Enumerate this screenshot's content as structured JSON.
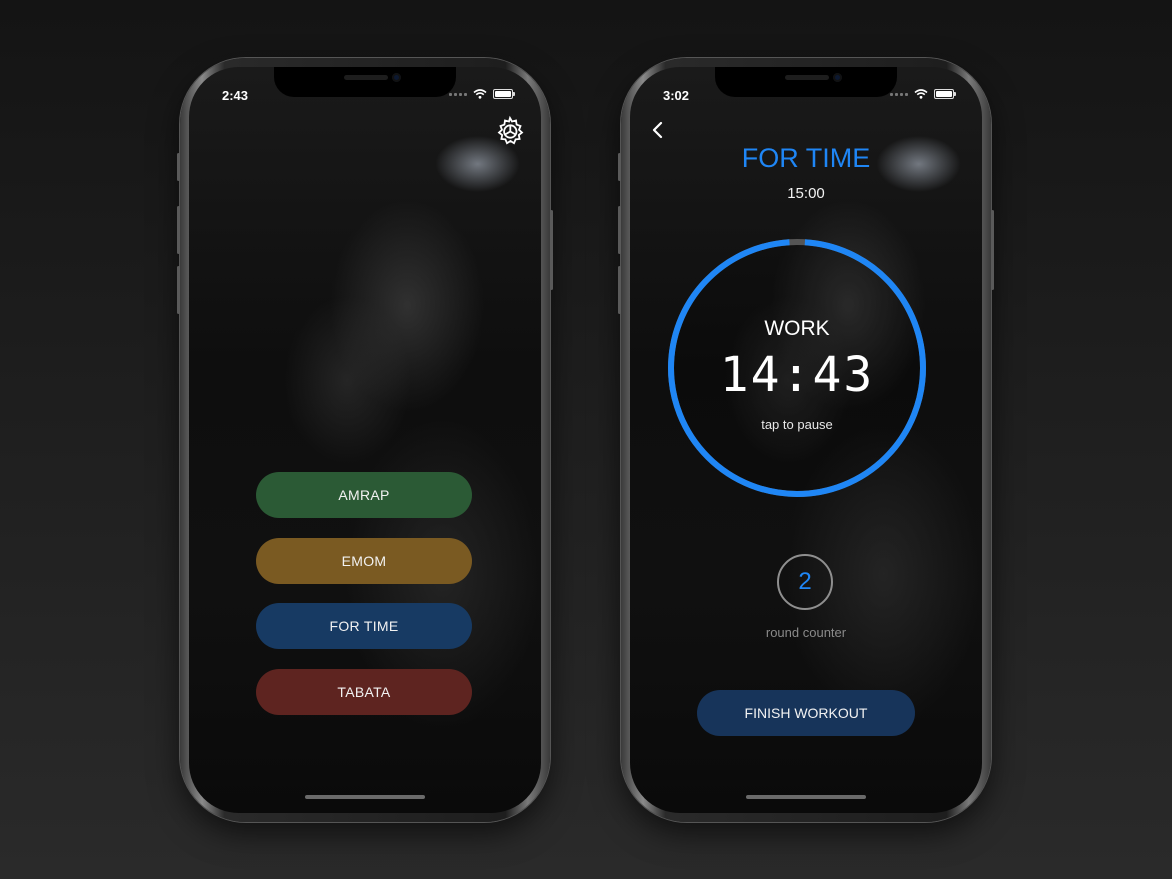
{
  "home_phone": {
    "status_time": "2:43",
    "settings_icon": "gear-icon",
    "modes": [
      {
        "label": "AMRAP",
        "color": "#2b5a35"
      },
      {
        "label": "EMOM",
        "color": "#7a5a22"
      },
      {
        "label": "FOR TIME",
        "color": "#173a63"
      },
      {
        "label": "TABATA",
        "color": "#5e2420"
      }
    ]
  },
  "timer_phone": {
    "status_time": "3:02",
    "back_icon": "chevron-left-icon",
    "title": "FOR TIME",
    "duration": "15:00",
    "phase": "WORK",
    "countdown": "14:43",
    "hint": "tap to pause",
    "progress_fraction": 0.98,
    "accent_color": "#1f86f5",
    "round_count": "2",
    "round_label": "round counter",
    "finish_label": "FINISH WORKOUT"
  }
}
